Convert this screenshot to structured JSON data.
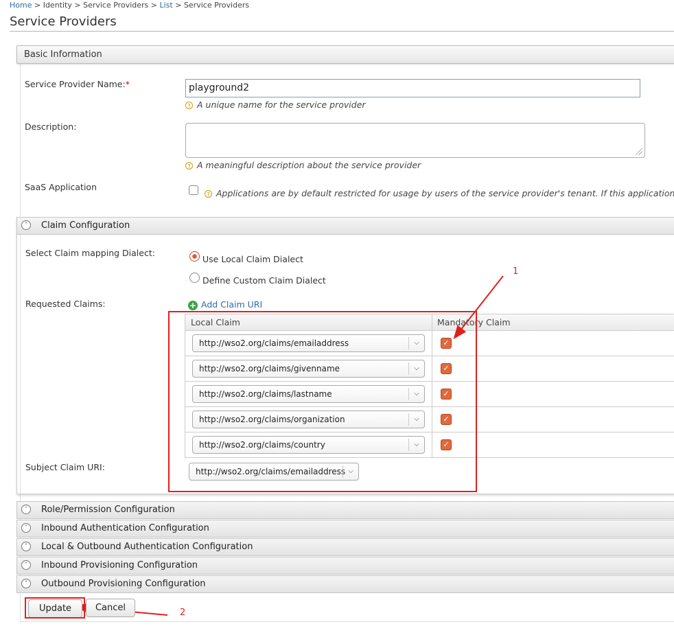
{
  "breadcrumb": {
    "home": "Home",
    "identity": "Identity",
    "service_providers": "Service Providers",
    "list": "List",
    "current": "Service Providers"
  },
  "page_title": "Service Providers",
  "basic_info": {
    "header": "Basic Information",
    "name_label": "Service Provider Name:",
    "required_mark": "*",
    "name_value": "playground2",
    "name_help": "A unique name for the service provider",
    "description_label": "Description:",
    "description_value": "",
    "description_help": "A meaningful description about the service provider",
    "saas_label": "SaaS Application",
    "saas_help": "Applications are by default restricted for usage by users of the service provider's tenant. If this application is S"
  },
  "claim_config": {
    "header": "Claim Configuration",
    "dialect_label": "Select Claim mapping Dialect:",
    "dialect_options": [
      "Use Local Claim Dialect",
      "Define Custom Claim Dialect"
    ],
    "dialect_selected": 0,
    "requested_label": "Requested Claims:",
    "add_claim": "Add Claim URI",
    "columns": [
      "Local Claim",
      "Mandatory Claim"
    ],
    "rows": [
      {
        "claim": "http://wso2.org/claims/emailaddress",
        "mandatory": true
      },
      {
        "claim": "http://wso2.org/claims/givenname",
        "mandatory": true
      },
      {
        "claim": "http://wso2.org/claims/lastname",
        "mandatory": true
      },
      {
        "claim": "http://wso2.org/claims/organization",
        "mandatory": true
      },
      {
        "claim": "http://wso2.org/claims/country",
        "mandatory": true
      }
    ],
    "subject_label": "Subject Claim URI:",
    "subject_value": "http://wso2.org/claims/emailaddress"
  },
  "collapsed_sections": [
    "Role/Permission Configuration",
    "Inbound Authentication Configuration",
    "Local & Outbound Authentication Configuration",
    "Inbound Provisioning Configuration",
    "Outbound Provisioning Configuration"
  ],
  "buttons": {
    "update": "Update",
    "cancel": "Cancel"
  },
  "annotations": {
    "one": "1",
    "two": "2"
  },
  "colors": {
    "annotation": "#e0201c",
    "link": "#2f6aa3",
    "checkbox": "#e06a3c"
  },
  "icons": [
    "help-icon",
    "chevron-up-icon",
    "chevron-down-icon",
    "plus-icon",
    "checkmark-icon",
    "dropdown-arrow-icon",
    "resize-grip-icon"
  ]
}
